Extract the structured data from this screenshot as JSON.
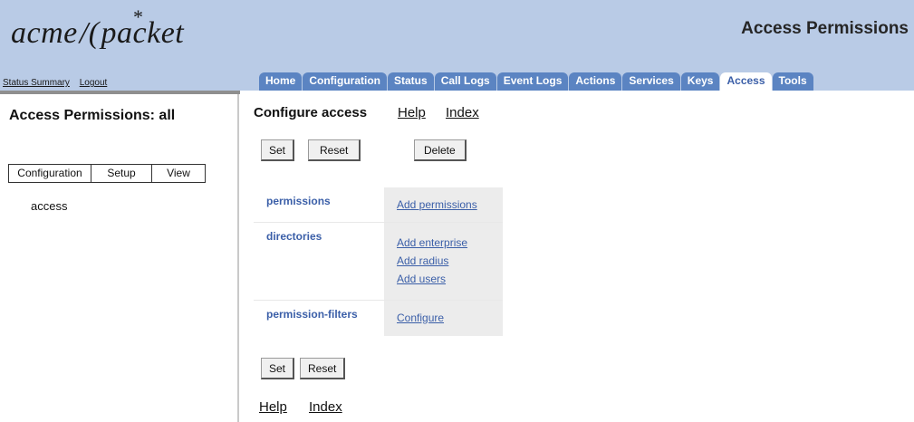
{
  "header": {
    "logo_left": "acme",
    "logo_right": "packet",
    "page_heading": "Access Permissions"
  },
  "top_links": {
    "status_summary": "Status Summary",
    "logout": "Logout"
  },
  "tabs": [
    "Home",
    "Configuration",
    "Status",
    "Call Logs",
    "Event Logs",
    "Actions",
    "Services",
    "Keys",
    "Access",
    "Tools"
  ],
  "active_tab": "Access",
  "sidebar": {
    "title": "Access Permissions: all",
    "mode_tabs": [
      "Configuration",
      "Setup",
      "View"
    ],
    "items": [
      "access"
    ]
  },
  "content": {
    "title": "Configure access",
    "help": "Help",
    "index": "Index",
    "buttons": {
      "set": "Set",
      "reset": "Reset",
      "delete": "Delete"
    },
    "sections": [
      {
        "name": "permissions",
        "actions": [
          "Add permissions"
        ]
      },
      {
        "name": "directories",
        "actions": [
          "Add enterprise",
          "Add radius",
          "Add users"
        ]
      },
      {
        "name": "permission-filters",
        "actions": [
          "Configure"
        ]
      }
    ]
  },
  "colors": {
    "header_bg": "#b9cbe6",
    "tab_bg": "#5b84c2",
    "link": "#3b5fa8"
  }
}
